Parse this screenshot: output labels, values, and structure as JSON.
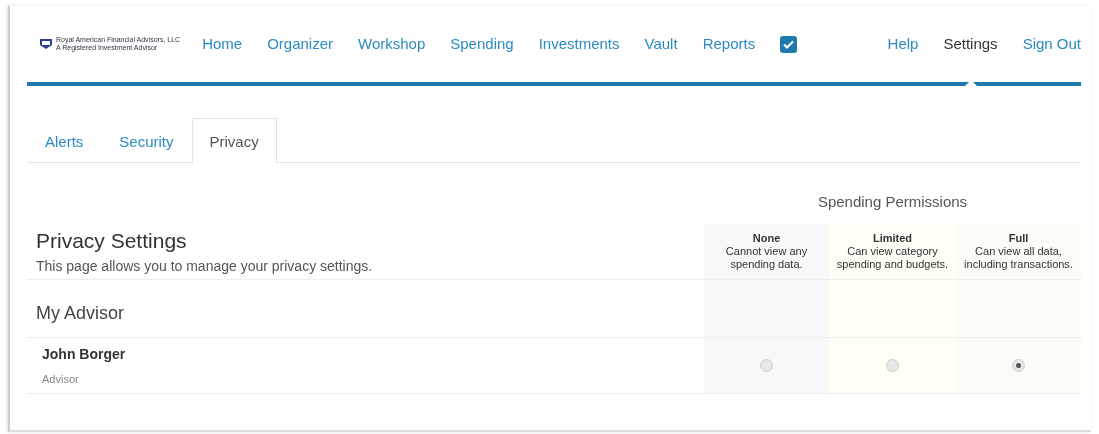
{
  "logo": {
    "name": "Royal American Financial Advisors, LLC",
    "tagline": "A Registered Investment Advisor"
  },
  "nav": [
    {
      "label": "Home",
      "selected": false
    },
    {
      "label": "Organizer",
      "selected": false
    },
    {
      "label": "Workshop",
      "selected": false
    },
    {
      "label": "Spending",
      "selected": false
    },
    {
      "label": "Investments",
      "selected": false
    },
    {
      "label": "Vault",
      "selected": false
    },
    {
      "label": "Reports",
      "selected": false
    }
  ],
  "nav_right": [
    {
      "label": "Help",
      "selected": false
    },
    {
      "label": "Settings",
      "selected": true
    },
    {
      "label": "Sign Out",
      "selected": false
    }
  ],
  "tabs": [
    {
      "label": "Alerts",
      "selected": false
    },
    {
      "label": "Security",
      "selected": false
    },
    {
      "label": "Privacy",
      "selected": true
    }
  ],
  "page": {
    "title": "Privacy Settings",
    "subtitle": "This page allows you to manage your privacy settings."
  },
  "permissions": {
    "title": "Spending Permissions",
    "levels": [
      {
        "name": "None",
        "description": "Cannot view any spending data."
      },
      {
        "name": "Limited",
        "description": "Can view category spending and budgets."
      },
      {
        "name": "Full",
        "description": "Can view all data, including transactions."
      }
    ]
  },
  "section": "My Advisor",
  "people": [
    {
      "name": "John Borger",
      "role": "Advisor",
      "choices": [
        {
          "selected": false
        },
        {
          "selected": false
        },
        {
          "selected": true
        }
      ]
    }
  ]
}
